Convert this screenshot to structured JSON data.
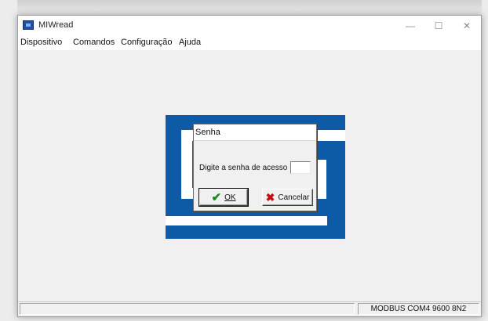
{
  "window": {
    "title": "MIWread",
    "minimize_glyph": "—",
    "maximize_glyph": "☐",
    "close_glyph": "✕"
  },
  "menu": {
    "items": [
      "Dispositivo",
      "Comandos",
      "Configuração",
      "Ajuda"
    ]
  },
  "status_bar": {
    "connection": "MODBUS COM4 9600 8N2"
  },
  "dialog": {
    "title": "Senha",
    "prompt": "Digite a senha de acesso",
    "password_value": "",
    "ok_label": "OK",
    "cancel_label": "Cancelar"
  },
  "icons": {
    "app": "app-icon",
    "ok": "check-icon",
    "cancel": "x-icon"
  },
  "colors": {
    "logo_blue": "#0d5aa7",
    "ok_green": "#1a8a1a",
    "cancel_red": "#c41010"
  }
}
